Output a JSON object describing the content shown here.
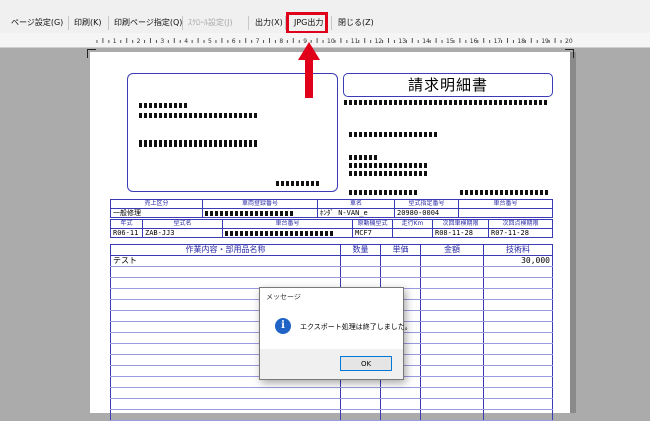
{
  "toolbar": {
    "buttons": [
      {
        "label": "ページ設定(G)",
        "disabled": false
      },
      {
        "label": "印刷(K)",
        "disabled": false
      },
      {
        "label": "印刷ページ指定(Q)",
        "disabled": false
      },
      {
        "label": "ｽｸﾛｰﾙ設定(J)",
        "disabled": true
      },
      {
        "label": "出力(X)",
        "disabled": false
      },
      {
        "label": "JPG出力",
        "disabled": false
      },
      {
        "label": "閉じる(Z)",
        "disabled": false
      }
    ]
  },
  "ruler": {
    "numbers": [
      "1",
      "2",
      "3",
      "4",
      "5",
      "6",
      "7",
      "8",
      "9",
      "10",
      "11",
      "12",
      "13",
      "14",
      "15",
      "16",
      "17",
      "18",
      "19",
      "20"
    ]
  },
  "invoice": {
    "title": "請求明細書",
    "header_row1": [
      "売上区分",
      "車両登録番号",
      "車名",
      "型式指定番号",
      "車台番号"
    ],
    "values_row1": [
      "一般修理",
      "",
      "ﾎﾝﾀﾞ N-VAN_e",
      "20980-0004",
      ""
    ],
    "header_row2": [
      "年式",
      "型式名",
      "車台番号",
      "原動機型式",
      "走行Km",
      "次回車検期限",
      "次回点検期限"
    ],
    "values_row2": [
      "R06-11",
      "ZAB-JJ3",
      "",
      "MCF7",
      "",
      "R08-11-28",
      "R07-11-28"
    ],
    "work_header": [
      "作業内容・部用品名称",
      "数量",
      "単価",
      "金額",
      "技術料"
    ],
    "work_rows": [
      {
        "name": "テスト",
        "qty": "",
        "price": "",
        "amount": "",
        "fee": "30,000"
      }
    ]
  },
  "dialog": {
    "title": "メッセージ",
    "message": "エクスポート処理は終了しました。",
    "ok_label": "OK"
  }
}
